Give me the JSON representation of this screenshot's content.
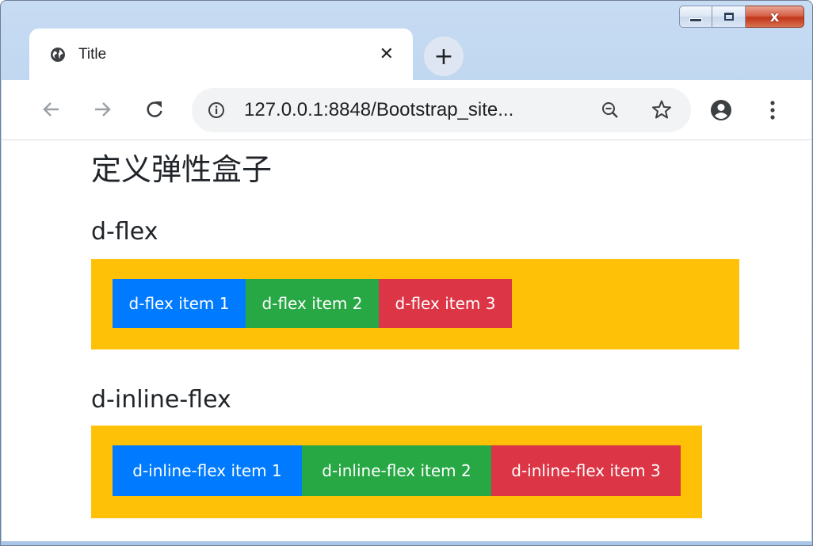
{
  "window": {
    "controls": {
      "minimize_icon": "minimize-icon",
      "maximize_icon": "maximize-icon",
      "close_glyph": "x"
    }
  },
  "tab": {
    "title": "Title",
    "icon": "globe-icon",
    "close_glyph": "✕"
  },
  "new_tab": {
    "glyph": "+"
  },
  "toolbar": {
    "back_icon": "back-arrow-icon",
    "forward_icon": "forward-arrow-icon",
    "reload_icon": "reload-icon",
    "url": "127.0.0.1:8848/Bootstrap_site...",
    "zoom_icon": "zoom-out-icon",
    "bookmark_icon": "star-icon",
    "account_icon": "account-icon",
    "menu_icon": "more-vert-icon"
  },
  "page": {
    "title": "定义弹性盒子",
    "sections": [
      {
        "heading": "d-flex",
        "items": [
          "d-flex item 1",
          "d-flex item 2",
          "d-flex item 3"
        ]
      },
      {
        "heading": "d-inline-flex",
        "items": [
          "d-inline-flex item 1",
          "d-inline-flex item 2",
          "d-inline-flex item 3"
        ]
      }
    ]
  },
  "colors": {
    "container": "#ffc107",
    "primary": "#007bff",
    "success": "#28a745",
    "danger": "#dc3545"
  }
}
